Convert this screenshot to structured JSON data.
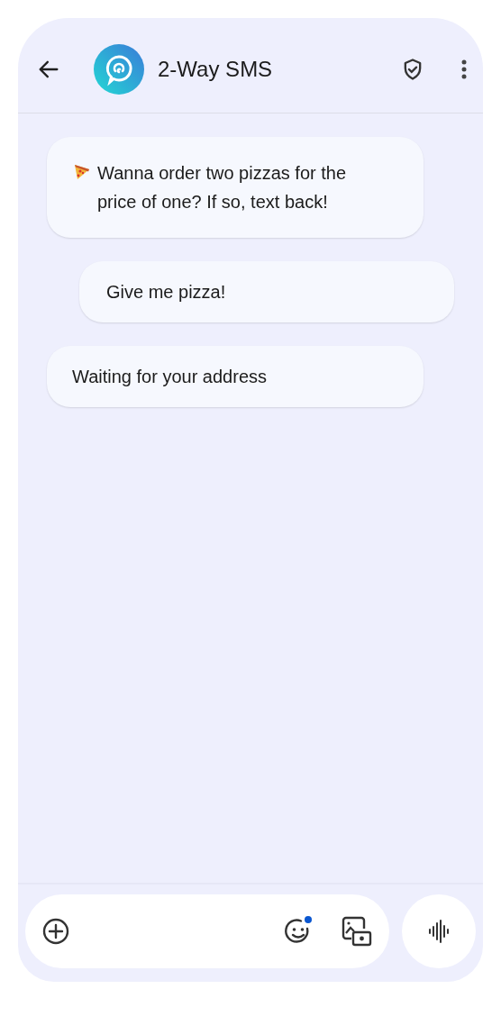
{
  "header": {
    "title": "2-Way SMS"
  },
  "messages": [
    {
      "kind": "incoming",
      "leading_icon": true,
      "text": "Wanna order two pizzas for the price of one? If so, text back!"
    },
    {
      "kind": "outgoing",
      "leading_icon": false,
      "text": "Give me pizza!"
    },
    {
      "kind": "incoming",
      "leading_icon": false,
      "text": "Waiting for your address"
    }
  ],
  "composer": {
    "emoji_badge": true
  }
}
